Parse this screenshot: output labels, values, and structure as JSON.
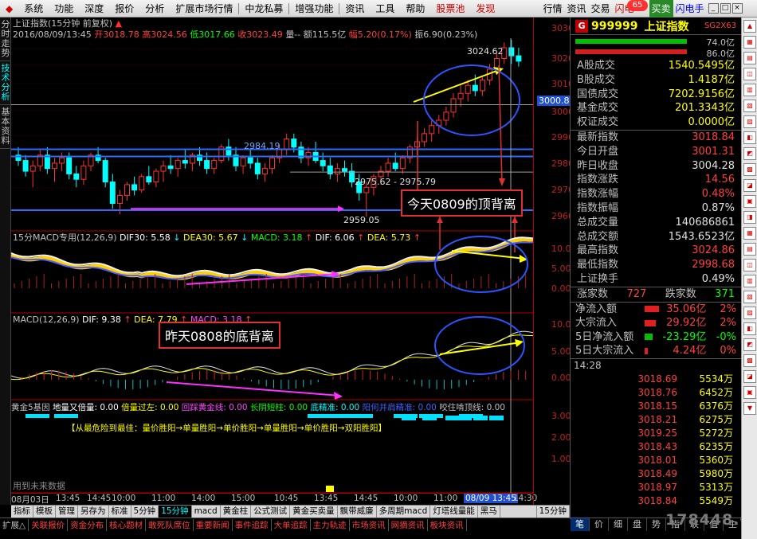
{
  "menu": {
    "items": [
      "系统",
      "功能",
      "深度",
      "报价",
      "分析",
      "扩展市场行情",
      "中龙私募",
      "增强功能",
      "资讯",
      "工具",
      "帮助"
    ],
    "right_items": [
      "股票池",
      "发现",
      "行情",
      "资讯",
      "交易",
      "闪电",
      "65",
      "买卖",
      "闪电手"
    ]
  },
  "left_tabs": [
    "分时走势",
    "技术分析",
    "基本资料"
  ],
  "main_header": {
    "title": "上证指数(15分钟 前复权)",
    "datetime": "2016/08/09/13:45",
    "open": "开3018.78",
    "high": "高3024.56",
    "low": "低3017.66",
    "close": "收3023.49",
    "vol": "量--",
    "amount": "额115.5亿",
    "change": "幅5.20(0.17%)",
    "amp": "振6.90(0.23%)"
  },
  "chart_labels": {
    "peak": "3024.62",
    "level1": "2984.19",
    "range": "2975.62 - 2975.79",
    "low": "2959.05",
    "price_tag": "3000.8"
  },
  "macd1_header": {
    "name": "15分MACD专用(12,26,9)",
    "dif30": "DIF30: 5.58",
    "dea30": "DEA30: 5.67",
    "macd": "MACD: 3.18",
    "dif": "DIF: 6.06",
    "dea": "DEA: 5.73"
  },
  "macd2_header": {
    "name": "MACD(12,26,9)",
    "dif": "DIF: 9.38",
    "dea": "DEA: 7.79",
    "macd": "MACD: 3.18"
  },
  "gold_header": {
    "name": "黄金5基因",
    "a": "地量又倍量: 0.00",
    "b": "倍量过左: 0.00",
    "c": "回踩黄金线: 0.00",
    "d": "长阴短柱: 0.00",
    "e": "底精准: 0.00",
    "f": "阳何并肩精准: 0.00",
    "g": "咬住啃顶线: 0.00"
  },
  "gold_line": "【从最危险到最佳：量价胜阳→单量胜阳→单价胜阳→单量胜阳→单价胜阳→双阳胜阳】",
  "future_label": "用到未来数据",
  "annotations": {
    "top": "今天0809的顶背离",
    "bottom": "昨天0808的底背离"
  },
  "axis": {
    "price": [
      "3030",
      "3020",
      "3010",
      "3000",
      "2990",
      "2980",
      "2970",
      "2960"
    ],
    "macd1": [
      "10.00",
      "5.00",
      "0.00"
    ],
    "macd2": [
      "10.00",
      "5.00",
      "0.00"
    ],
    "gold": [
      "3.00",
      "2.00",
      "1.00"
    ]
  },
  "time_axis": [
    "08月03日",
    "13:45",
    "14:45",
    "10:00",
    "11:00",
    "14:00",
    "15:00",
    "10:45",
    "13:45",
    "14:45",
    "10:00",
    "11:00",
    "14:00",
    "15:00",
    "10:45",
    "13:45",
    "08/09 13:45",
    "14:30"
  ],
  "bottom_tabs1": [
    "指标",
    "模板",
    "管理",
    "另存为",
    "标准",
    "5分钟",
    "15分钟",
    "macd",
    "黄金柱",
    "公式测试",
    "黄金买卖量",
    "飘带威廉",
    "多周期macd",
    "灯塔线量能",
    "黑马"
  ],
  "bottom_tabs1_right": "15分钟",
  "bottom_tabs2": [
    "扩展△",
    "关联报价",
    "资金分布",
    "核心题材",
    "敢死队席位",
    "重要新闻",
    "事件追踪",
    "大单追踪",
    "主力轨迹",
    "市场资讯",
    "网摘资讯",
    "板块资讯"
  ],
  "quote": {
    "code": "999999",
    "name": "上证指数",
    "sg": "SG2X63",
    "bar1_val": "74.0亿",
    "bar2_val": "86.0亿",
    "vols": [
      {
        "k": "A股成交",
        "v": "1540.5495亿"
      },
      {
        "k": "B股成交",
        "v": "1.4187亿"
      },
      {
        "k": "国债成交",
        "v": "7202.9156亿"
      },
      {
        "k": "基金成交",
        "v": "201.3343亿"
      },
      {
        "k": "权证成交",
        "v": "0.0000亿"
      }
    ],
    "stats": [
      {
        "k": "最新指数",
        "v": "3018.84",
        "c": "red"
      },
      {
        "k": "今日开盘",
        "v": "3001.31",
        "c": "red"
      },
      {
        "k": "昨日收盘",
        "v": "3004.28",
        "c": "white"
      },
      {
        "k": "指数涨跌",
        "v": "14.56",
        "c": "red"
      },
      {
        "k": "指数涨幅",
        "v": "0.48%",
        "c": "red"
      },
      {
        "k": "指数振幅",
        "v": "0.87%",
        "c": "white"
      },
      {
        "k": "总成交量",
        "v": "140686861",
        "c": "white"
      },
      {
        "k": "总成交额",
        "v": "1543.6523亿",
        "c": "white"
      },
      {
        "k": "最高指数",
        "v": "3024.86",
        "c": "red"
      },
      {
        "k": "最低指数",
        "v": "2998.68",
        "c": "red"
      },
      {
        "k": "上证换手",
        "v": "0.49%",
        "c": "white"
      }
    ],
    "updown": {
      "up_label": "涨家数",
      "up": "727",
      "down_label": "跌家数",
      "down": "371"
    },
    "flows": [
      {
        "k": "净流入额",
        "v": "35.06亿",
        "p": "2%",
        "c": "red",
        "w": 18
      },
      {
        "k": "大宗流入",
        "v": "29.92亿",
        "p": "2%",
        "c": "red",
        "w": 14
      },
      {
        "k": "5日净流入额",
        "v": "-23.29亿",
        "p": "-0%",
        "c": "green",
        "w": 10
      },
      {
        "k": "5日大宗流入",
        "v": "4.24亿",
        "p": "0%",
        "c": "red",
        "w": 4
      }
    ],
    "tick_time": "14:28",
    "ticks": [
      {
        "p": "3018.69",
        "v": "5534万"
      },
      {
        "p": "3018.76",
        "v": "6452万"
      },
      {
        "p": "3018.15",
        "v": "6376万"
      },
      {
        "p": "3018.21",
        "v": "6275万"
      },
      {
        "p": "3019.25",
        "v": "5272万"
      },
      {
        "p": "3018.43",
        "v": "6235万"
      },
      {
        "p": "3018.01",
        "v": "5360万"
      },
      {
        "p": "3018.49",
        "v": "5980万"
      },
      {
        "p": "3018.97",
        "v": "5313万"
      },
      {
        "p": "3018.84",
        "v": "5549万"
      }
    ],
    "tabs": [
      "笔",
      "价",
      "细",
      "盘",
      "势",
      "指",
      "联",
      "值",
      "主"
    ]
  },
  "watermark": "178448.COM"
}
